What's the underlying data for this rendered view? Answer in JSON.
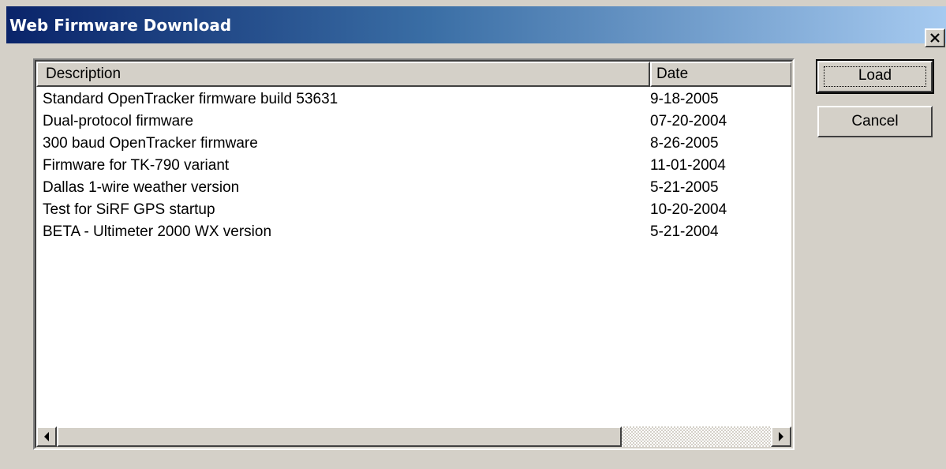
{
  "window": {
    "title": "Web Firmware Download",
    "close_icon": "close-icon"
  },
  "list": {
    "columns": [
      "Description",
      "Date"
    ],
    "rows": [
      {
        "description": "Standard OpenTracker firmware build 53631",
        "date": "9-18-2005"
      },
      {
        "description": "Dual-protocol firmware",
        "date": "07-20-2004"
      },
      {
        "description": "300 baud OpenTracker firmware",
        "date": "8-26-2005"
      },
      {
        "description": "Firmware for TK-790 variant",
        "date": "11-01-2004"
      },
      {
        "description": "Dallas 1-wire weather version",
        "date": "5-21-2005"
      },
      {
        "description": "Test for SiRF GPS startup",
        "date": "10-20-2004"
      },
      {
        "description": "BETA - Ultimeter 2000 WX version",
        "date": "5-21-2004"
      }
    ]
  },
  "buttons": {
    "load": "Load",
    "cancel": "Cancel"
  },
  "scrollbar": {
    "left_icon": "scroll-left-arrow-icon",
    "right_icon": "scroll-right-arrow-icon"
  },
  "colors": {
    "title_gradient_start": "#0a246a",
    "title_gradient_end": "#a6caf0",
    "face": "#d4d0c8"
  }
}
